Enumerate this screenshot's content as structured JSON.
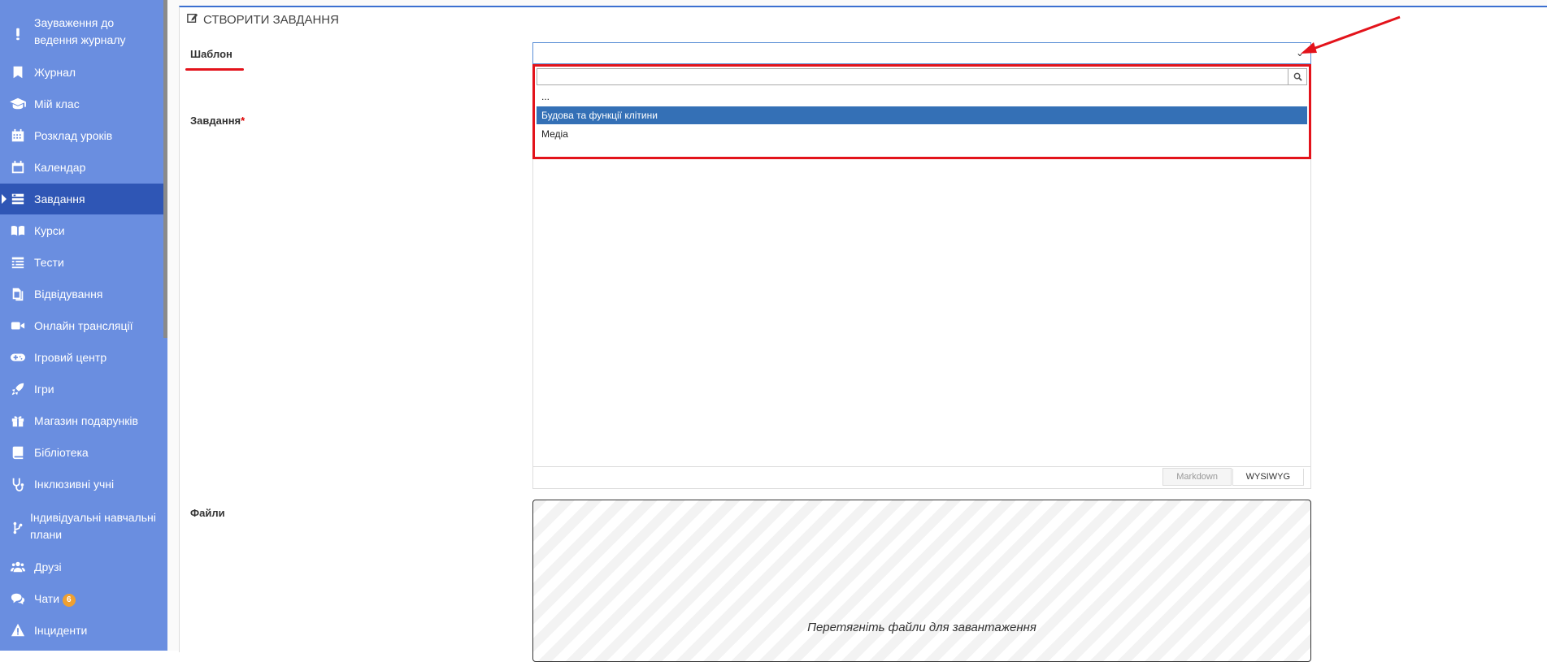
{
  "sidebar": {
    "items": [
      {
        "label": "Зауваження до ведення журналу",
        "icon": "exclamation-icon"
      },
      {
        "label": "Журнал",
        "icon": "bookmark-icon"
      },
      {
        "label": "Мій клас",
        "icon": "graduation-cap-icon"
      },
      {
        "label": "Розклад уроків",
        "icon": "calendar-grid-icon"
      },
      {
        "label": "Календар",
        "icon": "calendar-icon"
      },
      {
        "label": "Завдання",
        "icon": "tasks-icon",
        "active": true
      },
      {
        "label": "Курси",
        "icon": "book-open-icon"
      },
      {
        "label": "Тести",
        "icon": "list-icon"
      },
      {
        "label": "Відвідування",
        "icon": "copy-icon"
      },
      {
        "label": "Онлайн трансляції",
        "icon": "video-camera-icon"
      },
      {
        "label": "Ігровий центр",
        "icon": "gamepad-icon"
      },
      {
        "label": "Ігри",
        "icon": "rocket-icon"
      },
      {
        "label": "Магазин подарунків",
        "icon": "gift-icon"
      },
      {
        "label": "Бібліотека",
        "icon": "book-icon"
      },
      {
        "label": "Інклюзивні учні",
        "icon": "stethoscope-icon"
      },
      {
        "label": "Індивідуальні навчальні плани",
        "icon": "branch-icon"
      },
      {
        "label": "Друзі",
        "icon": "users-icon"
      },
      {
        "label": "Чати",
        "icon": "comments-icon",
        "badge": "6"
      },
      {
        "label": "Інциденти",
        "icon": "warning-icon"
      }
    ]
  },
  "panel": {
    "title": "СТВОРИТИ ЗАВДАННЯ",
    "title_icon": "edit-icon"
  },
  "form": {
    "template_label": "Шаблон",
    "template_value": "",
    "task_label": "Завдання",
    "required_mark": "*",
    "files_label": "Файли",
    "dropdown": {
      "search_value": "",
      "options": [
        "...",
        "Будова та функції клітини",
        "Медіа"
      ],
      "selected_index": 1
    },
    "editor_tabs": {
      "markdown": "Markdown",
      "wysiwyg": "WYSIWYG"
    },
    "dropzone_text": "Перетягніть файли для завантаження"
  },
  "colors": {
    "sidebar_bg": "#6a8ee0",
    "sidebar_active": "#2f56b5",
    "highlight_red": "#e3131b",
    "option_selected": "#3470b6",
    "badge": "#f0a030"
  }
}
